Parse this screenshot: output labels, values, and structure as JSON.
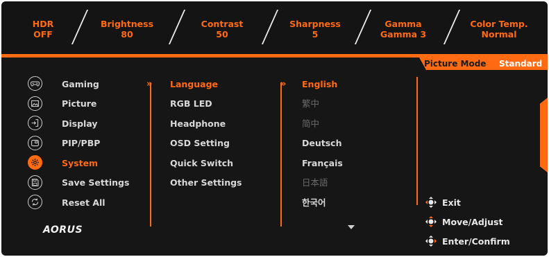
{
  "status_bar": [
    {
      "label": "HDR",
      "value": "OFF"
    },
    {
      "label": "Brightness",
      "value": "80"
    },
    {
      "label": "Contrast",
      "value": "50"
    },
    {
      "label": "Sharpness",
      "value": "5"
    },
    {
      "label": "Gamma",
      "value": "Gamma 3"
    },
    {
      "label": "Color Temp.",
      "value": "Normal"
    }
  ],
  "picture_mode": {
    "label": "Picture Mode",
    "value": "Standard"
  },
  "main_menu": [
    {
      "label": "Gaming",
      "icon": "gamepad-icon"
    },
    {
      "label": "Picture",
      "icon": "picture-icon"
    },
    {
      "label": "Display",
      "icon": "display-input-icon"
    },
    {
      "label": "PIP/PBP",
      "icon": "pip-icon"
    },
    {
      "label": "System",
      "icon": "gear-icon",
      "active": true
    },
    {
      "label": "Save Settings",
      "icon": "save-icon"
    },
    {
      "label": "Reset All",
      "icon": "reset-icon"
    }
  ],
  "system_menu": [
    {
      "label": "Language",
      "active": true
    },
    {
      "label": "RGB LED"
    },
    {
      "label": "Headphone"
    },
    {
      "label": "OSD Setting"
    },
    {
      "label": "Quick Switch"
    },
    {
      "label": "Other Settings"
    }
  ],
  "language_options": [
    {
      "label": "English",
      "state": "selected"
    },
    {
      "label": "繁中",
      "state": "disabled"
    },
    {
      "label": "简中",
      "state": "disabled"
    },
    {
      "label": "Deutsch",
      "state": "normal"
    },
    {
      "label": "Français",
      "state": "normal"
    },
    {
      "label": "日本語",
      "state": "disabled"
    },
    {
      "label": "한국어",
      "state": "normal"
    }
  ],
  "hints": [
    {
      "label": "Exit",
      "icon": "joystick-left-icon"
    },
    {
      "label": "Move/Adjust",
      "icon": "joystick-updown-icon"
    },
    {
      "label": "Enter/Confirm",
      "icon": "joystick-right-icon"
    }
  ],
  "logo_text": "AORUS",
  "colors": {
    "accent": "#ff6a13",
    "background": "#161616",
    "text": "#d8d8d8"
  }
}
